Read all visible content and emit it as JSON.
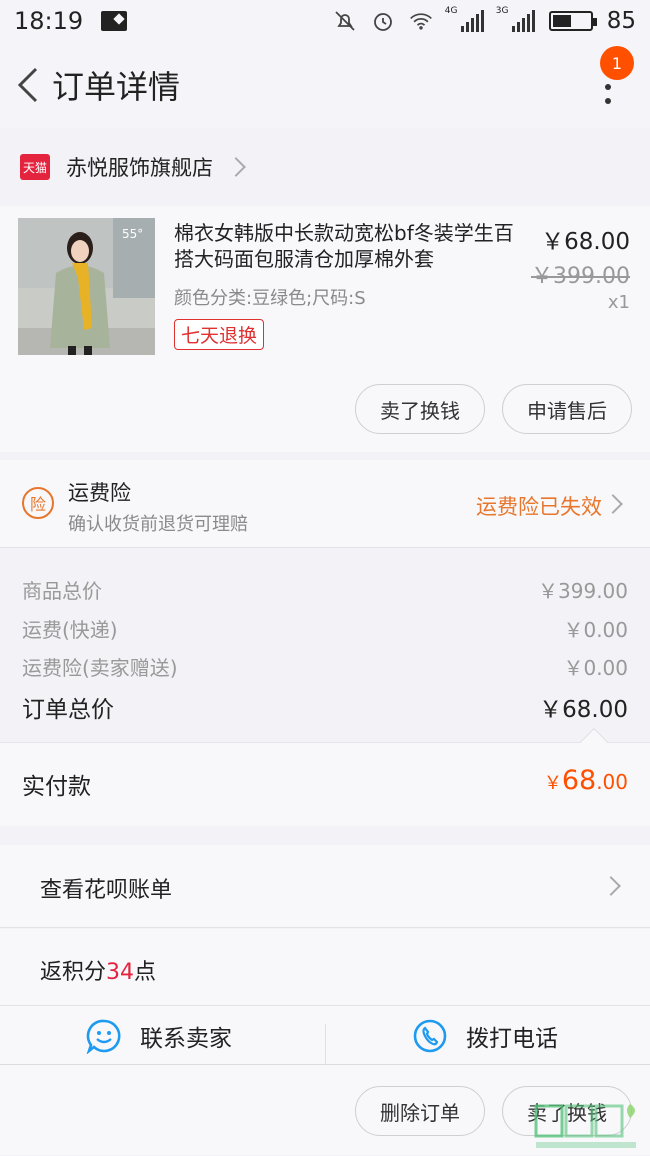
{
  "status_bar": {
    "time": "18:19",
    "network_1": "4G",
    "network_2": "3G",
    "battery": "85"
  },
  "header": {
    "title": "订单详情",
    "badge_count": "1"
  },
  "shop": {
    "logo_text": "天猫",
    "name": "赤悦服饰旗舰店"
  },
  "product": {
    "name": "棉衣女韩版中长款动宽松bf冬装学生百搭大码面包服清仓加厚棉外套",
    "sku": "颜色分类:豆绿色;尺码:S",
    "tag": "七天退换",
    "price": "￥68.00",
    "original_price": "￥399.00",
    "quantity": "x1",
    "thumb_text": "55°",
    "buttons": {
      "sell": "卖了换钱",
      "after_sale": "申请售后"
    }
  },
  "insurance": {
    "icon_text": "险",
    "title": "运费险",
    "subtitle": "确认收货前退货可理赔",
    "status": "运费险已失效"
  },
  "costs": {
    "rows": [
      {
        "label": "商品总价",
        "value": "￥399.00"
      },
      {
        "label": "运费(快递)",
        "value": "￥0.00"
      },
      {
        "label": "运费险(卖家赠送)",
        "value": "￥0.00"
      }
    ],
    "total_label": "订单总价",
    "total_value": "￥68.00"
  },
  "paid": {
    "label": "实付款",
    "currency": "￥",
    "integer": "68",
    "decimal": ".00"
  },
  "huabei": {
    "label": "查看花呗账单"
  },
  "points": {
    "prefix": "返积分",
    "number": "34",
    "suffix": "点"
  },
  "contact": {
    "seller": "联系卖家",
    "phone": "拨打电话"
  },
  "footer": {
    "delete": "删除订单",
    "sell": "卖了换钱"
  },
  "colors": {
    "accent": "#ff5000",
    "insurance_orange": "#e8762c",
    "tmall_red": "#e4243e",
    "icon_blue": "#1e9bf0"
  }
}
